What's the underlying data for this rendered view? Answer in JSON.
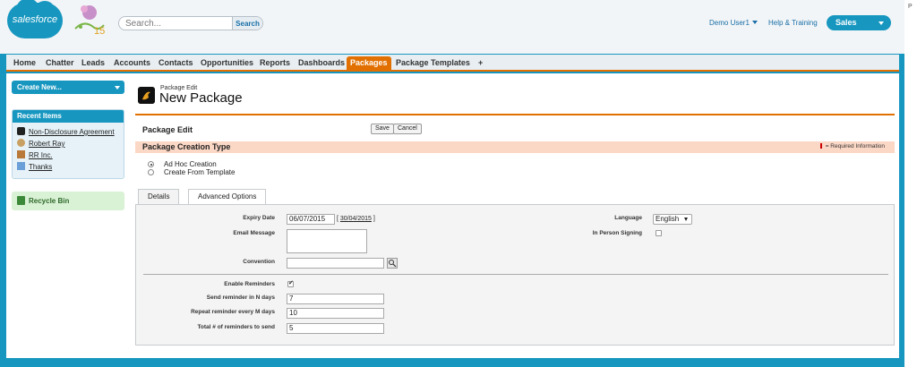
{
  "header": {
    "logo_text": "salesforce",
    "search_placeholder": "Search...",
    "search_button": "Search",
    "user_menu": "Demo User1",
    "help_link": "Help & Training",
    "app_switcher": "Sales",
    "side_text": "P"
  },
  "tabs": [
    "Home",
    "Chatter",
    "Leads",
    "Accounts",
    "Contacts",
    "Opportunities",
    "Reports",
    "Dashboards",
    "Packages",
    "Package Templates",
    "+"
  ],
  "active_tab": "Packages",
  "sidebar": {
    "create_new": "Create New...",
    "recent_title": "Recent Items",
    "recent_items": [
      "Non-Disclosure Agreement",
      "Robert Ray",
      "RR Inc.",
      "Thanks"
    ],
    "recycle_bin": "Recycle Bin"
  },
  "page": {
    "subtitle": "Package Edit",
    "title": "New Package"
  },
  "edit": {
    "title": "Package Edit",
    "save": "Save",
    "cancel": "Cancel",
    "section_label": "Package Creation Type",
    "required_info": "= Required Information",
    "radio_options": [
      "Ad Hoc Creation",
      "Create From Template"
    ],
    "selected_radio": "Ad Hoc Creation"
  },
  "subtabs": [
    "Details",
    "Advanced Options"
  ],
  "active_subtab": "Advanced Options",
  "fields": {
    "expiry_date_label": "Expiry Date",
    "expiry_date_value": "06/07/2015",
    "expiry_date_link": "30/04/2015",
    "email_message_label": "Email Message",
    "email_message_value": "",
    "convention_label": "Convention",
    "convention_value": "",
    "language_label": "Language",
    "language_value": "English",
    "in_person_label": "In Person Signing",
    "in_person_checked": false,
    "enable_reminders_label": "Enable Reminders",
    "enable_reminders_checked": true,
    "send_reminder_label": "Send reminder in N days",
    "send_reminder_value": "7",
    "repeat_reminder_label": "Repeat reminder every M days",
    "repeat_reminder_value": "10",
    "total_reminders_label": "Total # of reminders to send",
    "total_reminders_value": "5"
  },
  "colors": {
    "brand_blue": "#1797c0",
    "accent_orange": "#e27001",
    "section_pink": "#fbd7c6"
  }
}
